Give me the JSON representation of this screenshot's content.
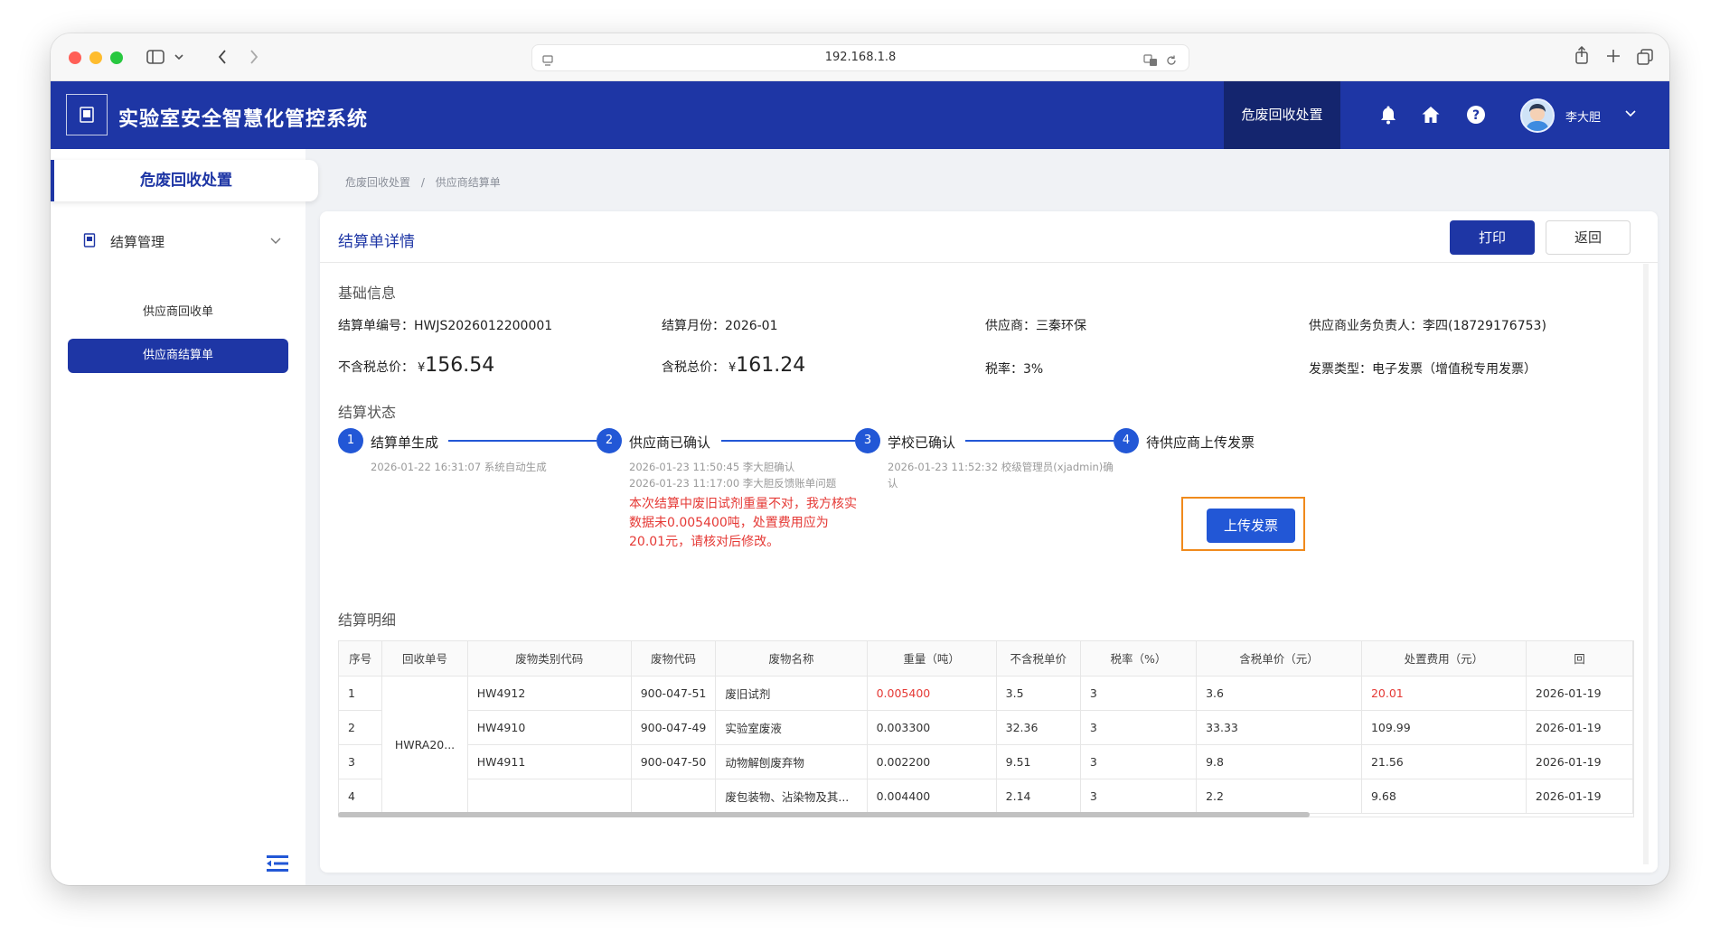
{
  "browser": {
    "url": "192.168.1.8"
  },
  "header": {
    "title": "实验室安全智慧化管控系统",
    "nav_active": "危废回收处置",
    "user_name": "李大胆",
    "icons": [
      "bell-icon",
      "home-icon",
      "help-icon"
    ]
  },
  "sidebar": {
    "section_title": "危废回收处置",
    "group_label": "结算管理",
    "items": [
      {
        "label": "供应商回收单",
        "active": false
      },
      {
        "label": "供应商结算单",
        "active": true
      }
    ]
  },
  "breadcrumb": [
    "危废回收处置",
    "/",
    "供应商结算单"
  ],
  "card": {
    "title": "结算单详情",
    "print_label": "打印",
    "back_label": "返回"
  },
  "basic_info": {
    "section_title": "基础信息",
    "settlement_no": "结算单编号：HWJS2026012200001",
    "settlement_month": "结算月份：2026-01",
    "supplier": "供应商：三秦环保",
    "supplier_contact": "供应商业务负责人：李四(18729176753)",
    "pretax_label": "不含税总价：",
    "pretax_currency": "¥",
    "pretax_value": "156.54",
    "tax_incl_label": "含税总价：",
    "tax_incl_currency": "¥",
    "tax_incl_value": "161.24",
    "tax_rate": "税率：3%",
    "invoice_type": "发票类型：电子发票（增值税专用发票）"
  },
  "status": {
    "section_title": "结算状态",
    "steps": [
      {
        "num": "1",
        "label": "结算单生成",
        "desc": [
          "2026-01-22 16:31:07 系统自动生成"
        ]
      },
      {
        "num": "2",
        "label": "供应商已确认",
        "desc": [
          "2026-01-23 11:50:45 李大胆确认",
          "2026-01-23 11:17:00 李大胆反馈账单问题"
        ],
        "warning": "本次结算中废旧试剂重量不对，我方核实数据未0.005400吨，处置费用应为20.01元，请核对后修改。"
      },
      {
        "num": "3",
        "label": "学校已确认",
        "desc": [
          "2026-01-23 11:52:32 校级管理员(xjadmin)确",
          "认"
        ]
      },
      {
        "num": "4",
        "label": "待供应商上传发票",
        "desc": []
      }
    ],
    "upload_label": "上传发票"
  },
  "detail": {
    "section_title": "结算明细",
    "columns": [
      "序号",
      "回收单号",
      "废物类别代码",
      "废物代码",
      "废物名称",
      "重量（吨）",
      "不含税单价",
      "税率（%）",
      "含税单价（元）",
      "处置费用（元）",
      "回"
    ],
    "merged_receipt_no": "HWRA20...",
    "rows": [
      {
        "seq": "1",
        "category": "HW4912",
        "code": "900-047-51",
        "name": "废旧试剂",
        "weight": "0.005400",
        "pretax_price": "3.5",
        "tax_rate": "3",
        "tax_price": "3.6",
        "fee": "20.01",
        "date": "2026-01-19",
        "highlight": true
      },
      {
        "seq": "2",
        "category": "HW4910",
        "code": "900-047-49",
        "name": "实验室废液",
        "weight": "0.003300",
        "pretax_price": "32.36",
        "tax_rate": "3",
        "tax_price": "33.33",
        "fee": "109.99",
        "date": "2026-01-19",
        "highlight": false
      },
      {
        "seq": "3",
        "category": "HW4911",
        "code": "900-047-50",
        "name": "动物解刨废弃物",
        "weight": "0.002200",
        "pretax_price": "9.51",
        "tax_rate": "3",
        "tax_price": "9.8",
        "fee": "21.56",
        "date": "2026-01-19",
        "highlight": false
      },
      {
        "seq": "4",
        "category": "",
        "code": "",
        "name": "废包装物、沾染物及其...",
        "weight": "0.004400",
        "pretax_price": "2.14",
        "tax_rate": "3",
        "tax_price": "2.2",
        "fee": "9.68",
        "date": "2026-01-19",
        "highlight": false
      }
    ]
  },
  "colors": {
    "brand": "#1e36a5",
    "brand_dark": "#14256e",
    "step": "#2257d6",
    "warning": "#e53935",
    "highlight_border": "#f08a1c"
  }
}
